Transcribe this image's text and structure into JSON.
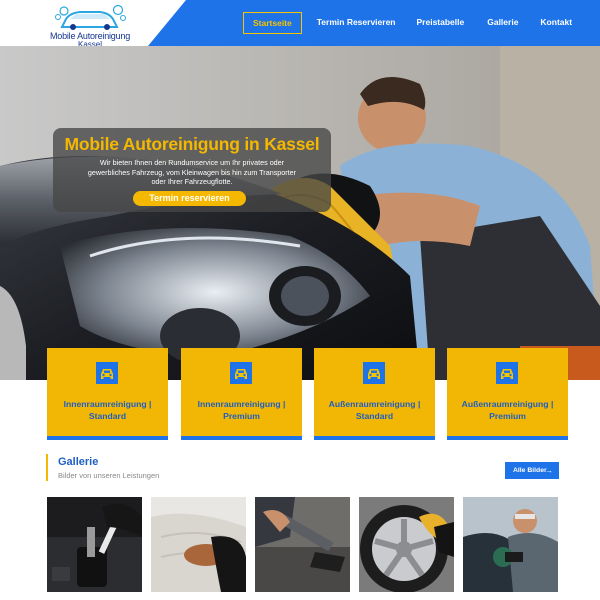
{
  "header": {
    "logo": {
      "line1": "Mobile Autoreinigung",
      "line2": "Kassel"
    },
    "nav": [
      {
        "label": "Startseite",
        "active": true
      },
      {
        "label": "Termin Reservieren",
        "active": false
      },
      {
        "label": "Preistabelle",
        "active": false
      },
      {
        "label": "Gallerie",
        "active": false
      },
      {
        "label": "Kontakt",
        "active": false
      }
    ]
  },
  "hero": {
    "title": "Mobile Autoreinigung in Kassel",
    "text": "Wir bieten Ihnen den Rundumservice um Ihr privates oder gewerbliches Fahrzeug, vom Kleinwagen bis hin zum Transporter oder Ihrer Fahrzeugflotte.",
    "button": "Termin reservieren"
  },
  "services": [
    {
      "title": "Innenraumreinigung | Standard",
      "icon": "car-icon"
    },
    {
      "title": "Innenraumreinigung | Premium",
      "icon": "car-icon"
    },
    {
      "title": "Außenraumreinigung | Standard",
      "icon": "car-icon"
    },
    {
      "title": "Außenraumreinigung | Premium",
      "icon": "car-icon"
    }
  ],
  "gallery": {
    "title": "Gallerie",
    "subtitle": "Bilder von unseren Leistungen",
    "button": "Alle Bilder",
    "button_icon": "arrow-right-icon",
    "images": [
      "gear-shift-cleaning-photo",
      "seat-brush-cleaning-photo",
      "interior-vacuum-photo",
      "rim-cleaning-photo",
      "car-polishing-photo"
    ]
  },
  "colors": {
    "primary": "#1e73e8",
    "accent": "#f5b800",
    "card": "#f2b705"
  }
}
